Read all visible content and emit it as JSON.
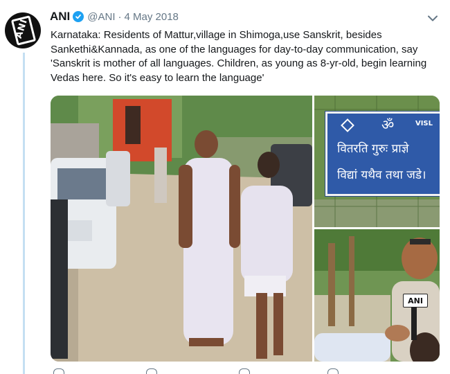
{
  "tweet": {
    "author_name": "ANI",
    "handle": "@ANI",
    "separator": "·",
    "date": "4 May 2018",
    "text": "Karnataka: Residents of Mattur,village in Shimoga,use Sanskrit, besides Sankethi&Kannada, as one of the languages for day-to-day communication, say 'Sanskrit is mother of all languages. Children, as young as 8-yr-old, begin learning Vedas here. So it's easy to learn the language'",
    "verified": true,
    "avatar_logo_text": "ANI",
    "icons": {
      "verified": "verified-badge-icon",
      "menu": "chevron-down-icon",
      "om": "om-symbol-icon"
    }
  },
  "media": {
    "sign_om": "ॐ",
    "sign_brand": "VISL",
    "sign_line1": "वितरति गुरुः प्राज्ञे",
    "sign_line2": "विद्यां यथैव तथा जडे।",
    "mic_flag_text": "ANI"
  },
  "colors": {
    "accent": "#1da1f2",
    "thread_line": "#c4dff2",
    "sign_blue": "#2f5aa8",
    "muted_text": "#657786"
  }
}
